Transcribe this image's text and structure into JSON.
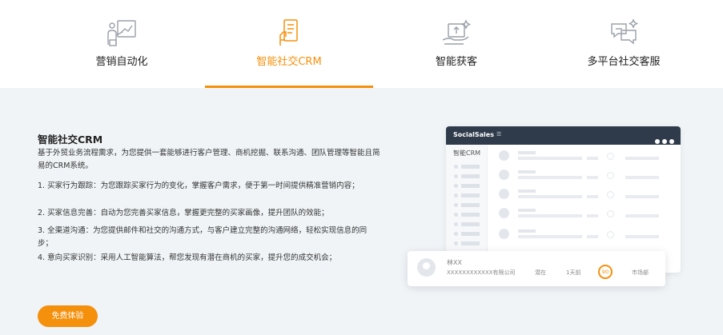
{
  "tabs": [
    {
      "label": "营销自动化",
      "icon": "marketing-automation-icon"
    },
    {
      "label": "智能社交CRM",
      "icon": "social-crm-icon",
      "active": true
    },
    {
      "label": "智能获客",
      "icon": "customer-acquisition-icon"
    },
    {
      "label": "多平台社交客服",
      "icon": "multi-platform-service-icon"
    }
  ],
  "accent_color": "#f5900c",
  "content": {
    "title": "智能社交CRM",
    "intro": "基于外贸业务流程需求，为您提供一套能够进行客户管理、商机挖掘、联系沟通、团队管理等智能且简易的CRM系统。",
    "features": [
      "1. 买家行为跟踪：为您跟踪买家行为的变化，掌握客户需求，便于第一时间提供精准营销内容；",
      "2. 买家信息完善：自动为您完善买家信息，掌握更完整的买家画像，提升团队的效能；",
      "3. 全渠道沟通：为您提供邮件和社交的沟通方式，与客户建立完整的沟通网络，轻松实现信息的同步；",
      "4. 意向买家识别：采用人工智能算法，帮您发现有潜在商机的买家，提升您的成交机会；"
    ],
    "cta_label": "免费体验"
  },
  "mockup": {
    "brand": "SocialSales",
    "menu_glyph": "☰",
    "sidebar_title": "智能CRM",
    "card": {
      "name": "林XX",
      "company": "XXXXXXXXXXXX有限公司",
      "status": "潜在",
      "days": "1天前",
      "score": "90",
      "dept": "市场部"
    }
  }
}
